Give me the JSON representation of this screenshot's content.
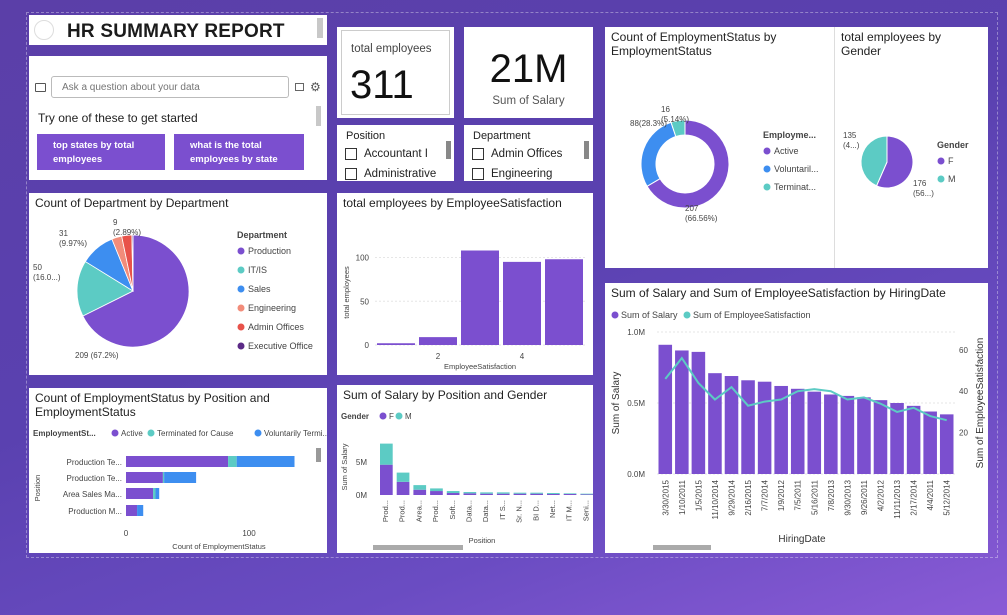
{
  "title": "HR SUMMARY REPORT",
  "qa": {
    "placeholder": "Ask a question about your data",
    "prompt": "Try one of these to get started",
    "suggestions": [
      "top states by total employees",
      "what is the total employees by state"
    ]
  },
  "kpi_total_employees": {
    "label": "total employees",
    "value": "311"
  },
  "kpi_salary": {
    "value": "21M",
    "label": "Sum of Salary"
  },
  "slicer_position": {
    "title": "Position",
    "items": [
      "Accountant I",
      "Administrative"
    ]
  },
  "slicer_department": {
    "title": "Department",
    "items": [
      "Admin Offices",
      "Engineering"
    ]
  },
  "colors": {
    "purple": "#7b4fcf",
    "teal": "#5ccbc4",
    "blue": "#3d8ef0",
    "salmon": "#f28c7a",
    "red": "#e8524a",
    "darkpurple": "#5b2a86"
  },
  "chart_data": [
    {
      "id": "emp_status_donut",
      "type": "pie",
      "title": "Count of EmploymentStatus by EmploymentStatus",
      "legend_title": "Employme...",
      "legend": [
        "Active",
        "Voluntaril...",
        "Terminat..."
      ],
      "values": [
        207,
        88,
        16
      ],
      "labels": [
        "207\n(66.56%)",
        "88(28.3%)",
        "16\n(5.14%)"
      ]
    },
    {
      "id": "gender_pie",
      "type": "pie",
      "title": "total employees by Gender",
      "legend_title": "Gender",
      "legend": [
        "F",
        "M"
      ],
      "values": [
        176,
        135
      ],
      "labels": [
        "176\n(56...)",
        "135\n(4...)"
      ]
    },
    {
      "id": "dept_pie",
      "type": "pie",
      "title": "Count of Department by Department",
      "legend_title": "Department",
      "legend": [
        "Production",
        "IT/IS",
        "Sales",
        "Engineering",
        "Admin Offices",
        "Executive Office"
      ],
      "values": [
        209,
        50,
        31,
        9,
        9,
        1
      ],
      "labels": [
        "209 (67.2%)",
        "50\n(16.0...)",
        "31\n(9.97%)",
        "9\n(2.89%)"
      ]
    },
    {
      "id": "satisfaction_bar",
      "type": "bar",
      "title": "total employees by EmployeeSatisfaction",
      "xlabel": "EmployeeSatisfaction",
      "ylabel": "total employees",
      "categories": [
        1,
        2,
        3,
        4,
        5
      ],
      "values": [
        2,
        9,
        108,
        95,
        98
      ],
      "yticks": [
        0,
        50,
        100
      ],
      "xticks": [
        "2",
        "4"
      ]
    },
    {
      "id": "status_by_position",
      "type": "bar",
      "title": "Count of EmploymentStatus by Position and EmploymentStatus",
      "ylabel": "Position",
      "xlabel": "Count of EmploymentStatus",
      "legend_title": "EmploymentSt...",
      "legend": [
        "Active",
        "Terminated for Cause",
        "Voluntarily Termi..."
      ],
      "categories": [
        "Production Te...",
        "Production Te...",
        "Area Sales Ma...",
        "Production M..."
      ],
      "series": [
        {
          "name": "Active",
          "values": [
            83,
            30,
            22,
            9
          ]
        },
        {
          "name": "Terminated for Cause",
          "values": [
            7,
            1,
            2,
            0
          ]
        },
        {
          "name": "Voluntarily Termi...",
          "values": [
            47,
            26,
            3,
            5
          ]
        }
      ],
      "xticks": [
        "0",
        "100"
      ]
    },
    {
      "id": "salary_by_position_gender",
      "type": "bar",
      "title": "Sum of Salary by Position and Gender",
      "ylabel": "Sum of Salary",
      "xlabel": "Position",
      "legend_title": "Gender",
      "legend": [
        "F",
        "M"
      ],
      "categories": [
        "Prod...",
        "Prod...",
        "Area...",
        "Prod...",
        "Soft...",
        "Data...",
        "Data...",
        "IT S...",
        "Sr. N...",
        "BI D...",
        "Net...",
        "IT M...",
        "Seni..."
      ],
      "series": [
        {
          "name": "F",
          "values": [
            4.6,
            2.0,
            0.8,
            0.6,
            0.3,
            0.25,
            0.2,
            0.2,
            0.2,
            0.2,
            0.15,
            0.15,
            0.1
          ]
        },
        {
          "name": "M",
          "values": [
            3.2,
            1.4,
            0.7,
            0.4,
            0.3,
            0.2,
            0.2,
            0.2,
            0.15,
            0.15,
            0.15,
            0.1,
            0.1
          ]
        }
      ],
      "yticks": [
        "0M",
        "5M"
      ]
    },
    {
      "id": "salary_satisfaction_by_date",
      "type": "bar",
      "title": "Sum of Salary and Sum of EmployeeSatisfaction by HiringDate",
      "xlabel": "HiringDate",
      "ylabel": "Sum of Salary",
      "y2label": "Sum of EmployeeSatisfaction",
      "legend": [
        "Sum of Salary",
        "Sum of EmployeeSatisfaction"
      ],
      "categories": [
        "3/30/2015",
        "1/10/2011",
        "1/5/2015",
        "11/10/2014",
        "9/29/2014",
        "2/16/2015",
        "7/7/2014",
        "1/9/2012",
        "7/5/2011",
        "5/16/2011",
        "7/8/2013",
        "9/30/2013",
        "9/26/2011",
        "4/2/2012",
        "11/11/2013",
        "2/17/2014",
        "4/4/2011",
        "5/12/2014"
      ],
      "xtick_labels": [
        "3/30/2015",
        "1/10/2011",
        "1/5/2015",
        "11/10/2014",
        "9/29/2014",
        "2/16/2015",
        "7/7/2014",
        "1/9/2012",
        "7/5/2011",
        "5/16/2011",
        "7/8/2013",
        "9/30/2013",
        "9/26/2011",
        "4/2/2012",
        "11/11/2013",
        "2/17/2014",
        "4/4/2011",
        "5/12/2014"
      ],
      "bars": [
        0.91,
        0.87,
        0.86,
        0.71,
        0.69,
        0.66,
        0.65,
        0.62,
        0.6,
        0.58,
        0.56,
        0.55,
        0.54,
        0.52,
        0.5,
        0.48,
        0.44,
        0.42
      ],
      "line": [
        46,
        56,
        44,
        36,
        42,
        33,
        35,
        36,
        40,
        41,
        40,
        36,
        37,
        34,
        30,
        32,
        28,
        26
      ],
      "yticks": [
        "0.0M",
        "0.5M",
        "1.0M"
      ],
      "y2ticks": [
        "20",
        "40",
        "60"
      ]
    }
  ]
}
